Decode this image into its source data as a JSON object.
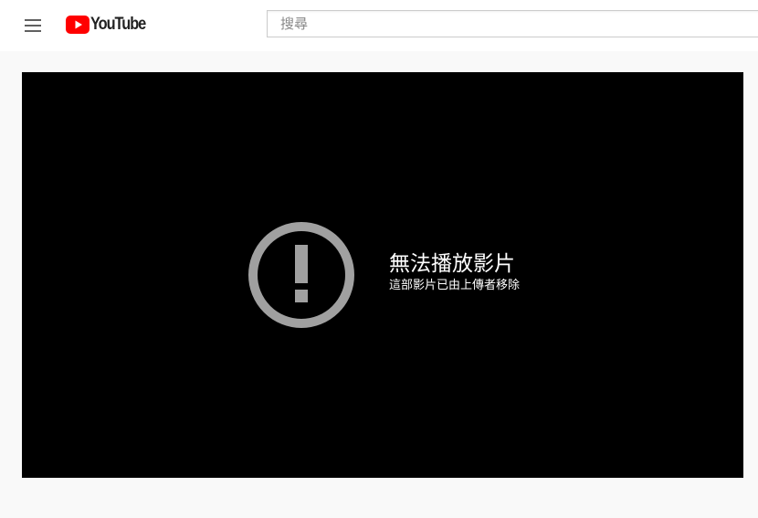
{
  "header": {
    "menu_icon": "hamburger-menu-icon",
    "logo_text": "YouTube",
    "logo_color": "#ff0000",
    "search": {
      "placeholder": "搜尋",
      "value": ""
    }
  },
  "player": {
    "error_icon": "exclamation-circle-icon",
    "error_title": "無法播放影片",
    "error_reason": "這部影片已由上傳者移除"
  }
}
